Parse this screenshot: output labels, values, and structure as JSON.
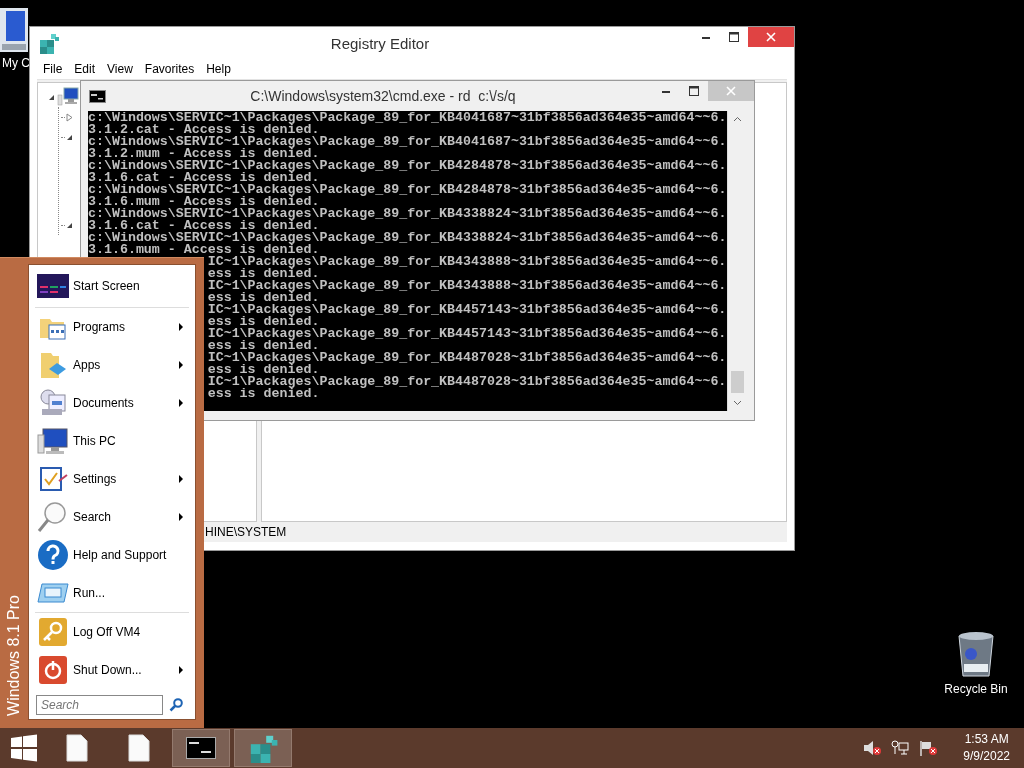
{
  "desktop_icons": [
    {
      "label": "My C"
    },
    {
      "label": "Recycle Bin"
    }
  ],
  "registry_editor": {
    "title": "Registry Editor",
    "menu": [
      "File",
      "Edit",
      "View",
      "Favorites",
      "Help"
    ],
    "tree": [
      {
        "expanded": true,
        "children": [
          {
            "expanded": false
          },
          {
            "expanded": true
          },
          {
            "expanded": true
          }
        ]
      }
    ],
    "status_bar": "HINE\\SYSTEM"
  },
  "command_prompt": {
    "title": "C:\\Windows\\system32\\cmd.exe - rd  c:\\/s/q",
    "lines": [
      {
        "kind": "full",
        "text": "c:\\Windows\\SERVIC~1\\Packages\\Package_89_for_KB4041687~31bf3856ad364e35~amd64~~6."
      },
      {
        "kind": "full",
        "text": "3.1.2.cat - Access is denied."
      },
      {
        "kind": "full",
        "text": "c:\\Windows\\SERVIC~1\\Packages\\Package_89_for_KB4041687~31bf3856ad364e35~amd64~~6."
      },
      {
        "kind": "full",
        "text": "3.1.2.mum - Access is denied."
      },
      {
        "kind": "full",
        "text": "c:\\Windows\\SERVIC~1\\Packages\\Package_89_for_KB4284878~31bf3856ad364e35~amd64~~6."
      },
      {
        "kind": "full",
        "text": "3.1.6.cat - Access is denied."
      },
      {
        "kind": "full",
        "text": "c:\\Windows\\SERVIC~1\\Packages\\Package_89_for_KB4284878~31bf3856ad364e35~amd64~~6."
      },
      {
        "kind": "full",
        "text": "3.1.6.mum - Access is denied."
      },
      {
        "kind": "full",
        "text": "c:\\Windows\\SERVIC~1\\Packages\\Package_89_for_KB4338824~31bf3856ad364e35~amd64~~6."
      },
      {
        "kind": "full",
        "text": "3.1.6.cat - Access is denied."
      },
      {
        "kind": "full",
        "text": "c:\\Windows\\SERVIC~1\\Packages\\Package_89_for_KB4338824~31bf3856ad364e35~amd64~~6."
      },
      {
        "kind": "full",
        "text": "3.1.6.mum - Access is denied."
      },
      {
        "kind": "covered",
        "text": "IC~1\\Packages\\Package_89_for_KB4343888~31bf3856ad364e35~amd64~~6."
      },
      {
        "kind": "covered",
        "text": "ess is denied."
      },
      {
        "kind": "covered",
        "text": "IC~1\\Packages\\Package_89_for_KB4343888~31bf3856ad364e35~amd64~~6."
      },
      {
        "kind": "covered",
        "text": "ess is denied."
      },
      {
        "kind": "covered",
        "text": "IC~1\\Packages\\Package_89_for_KB4457143~31bf3856ad364e35~amd64~~6."
      },
      {
        "kind": "covered",
        "text": "ess is denied."
      },
      {
        "kind": "covered",
        "text": "IC~1\\Packages\\Package_89_for_KB4457143~31bf3856ad364e35~amd64~~6."
      },
      {
        "kind": "covered",
        "text": "ess is denied."
      },
      {
        "kind": "covered",
        "text": "IC~1\\Packages\\Package_89_for_KB4487028~31bf3856ad364e35~amd64~~6."
      },
      {
        "kind": "covered",
        "text": "ess is denied."
      },
      {
        "kind": "covered",
        "text": "IC~1\\Packages\\Package_89_for_KB4487028~31bf3856ad364e35~amd64~~6."
      },
      {
        "kind": "covered",
        "text": "ess is denied."
      }
    ]
  },
  "start_menu": {
    "edition": "Windows 8.1 Pro",
    "sections": [
      [
        {
          "label": "Start Screen",
          "submenu": false
        }
      ],
      [
        {
          "label": "Programs",
          "submenu": true
        },
        {
          "label": "Apps",
          "submenu": true
        },
        {
          "label": "Documents",
          "submenu": true
        },
        {
          "label": "This PC",
          "submenu": false
        },
        {
          "label": "Settings",
          "submenu": true
        },
        {
          "label": "Search",
          "submenu": true
        },
        {
          "label": "Help and Support",
          "submenu": false
        },
        {
          "label": "Run...",
          "submenu": false
        }
      ],
      [
        {
          "label": "Log Off VM4",
          "submenu": false
        },
        {
          "label": "Shut Down...",
          "submenu": true
        }
      ]
    ],
    "search": {
      "placeholder": "Search"
    }
  },
  "taskbar": {
    "buttons": [
      {
        "open": false
      },
      {
        "open": false
      },
      {
        "open": true
      },
      {
        "open": true
      }
    ],
    "clock": {
      "time": "1:53 AM",
      "date": "9/9/2022"
    }
  }
}
